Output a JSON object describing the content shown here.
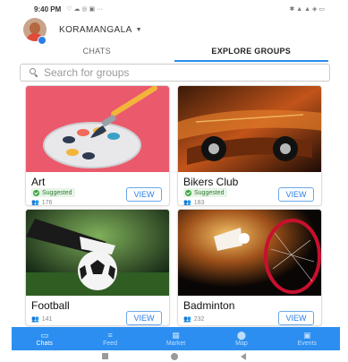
{
  "status_bar": {
    "time": "9:40 PM",
    "left_icons": "♡ ☁ ◎ ▣ ···",
    "right_icons": "✱ ▲ ▲ ◈ ▭"
  },
  "header": {
    "location": "KORAMANGALA",
    "caret": "▼"
  },
  "tabs": [
    {
      "label": "CHATS",
      "active": false
    },
    {
      "label": "EXPLORE GROUPS",
      "active": true
    }
  ],
  "search": {
    "placeholder": "Search for groups",
    "value": ""
  },
  "groups": [
    {
      "title": "Art",
      "suggested": true,
      "badge_label": "Suggested",
      "members": "176",
      "button": "VIEW"
    },
    {
      "title": "Bikers Club",
      "suggested": true,
      "badge_label": "Suggested",
      "members": "183",
      "button": "VIEW"
    },
    {
      "title": "Football",
      "suggested": false,
      "members": "141",
      "button": "VIEW"
    },
    {
      "title": "Badminton",
      "suggested": false,
      "members": "232",
      "button": "VIEW"
    }
  ],
  "bottom_nav": [
    {
      "label": "Chats",
      "icon": "chat-icon",
      "active": true
    },
    {
      "label": "Feed",
      "icon": "feed-icon",
      "active": false
    },
    {
      "label": "Market",
      "icon": "market-icon",
      "active": false
    },
    {
      "label": "Map",
      "icon": "map-pin-icon",
      "active": false
    },
    {
      "label": "Events",
      "icon": "calendar-icon",
      "active": false
    }
  ],
  "colors": {
    "accent": "#2b8ef0",
    "suggested": "#3aa53f",
    "art_bg": "#e8556a"
  }
}
